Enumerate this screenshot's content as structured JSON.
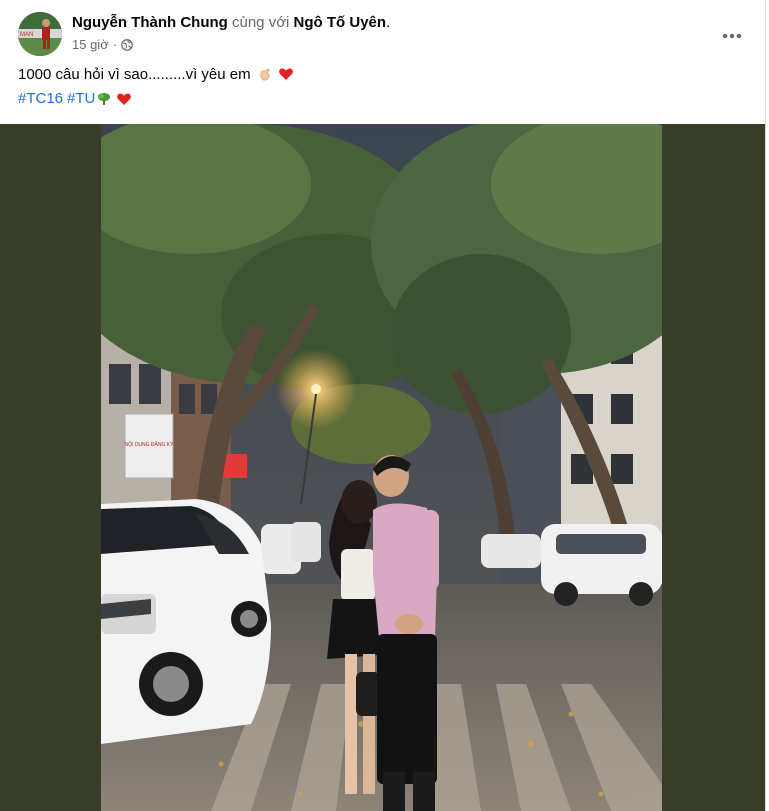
{
  "post": {
    "author": "Nguyễn Thành Chung",
    "with_text": "cùng với",
    "tagged_user": "Ngô Tố Uyên",
    "tagged_suffix": ".",
    "time": "15 giờ",
    "caption": "1000 câu hỏi vì sao.........vì yêu em",
    "hashtags": [
      "#TC16",
      "#TU"
    ],
    "audience_icon": "globe-icon",
    "more_icon": "more-options-icon"
  },
  "photo": {
    "signs": {
      "shop_sign": "NỘI DUNG ĐĂNG KÝ"
    }
  },
  "colors": {
    "link": "#216fdb",
    "secondary_text": "#65676b",
    "photo_backdrop": "#373d28"
  }
}
